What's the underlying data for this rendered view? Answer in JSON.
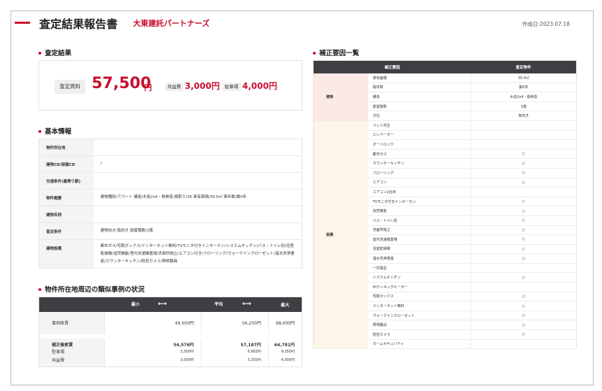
{
  "header": {
    "title": "査定結果報告書",
    "company": "大東建託パートナーズ",
    "date": "作成日:2023.07.18"
  },
  "result": {
    "heading": "査定結果",
    "rent_label": "査定賃料",
    "rent_value": "57,500",
    "rent_unit": "円",
    "common_fee_label": "共益費",
    "common_fee_value": "3,000円",
    "parking_label": "駐車場",
    "parking_value": "4,000円"
  },
  "basic": {
    "heading": "基本情報",
    "rows": [
      {
        "key": "物件所在地",
        "value": ""
      },
      {
        "key": "建物CD/部屋CD",
        "value": "/"
      },
      {
        "key": "交通条件(最寄り駅)",
        "value": ""
      },
      {
        "key": "物件概要",
        "value": "建物種別/アパート 構造/木造2x4・鉄骨造 間取り/1K 専有面積/30.0㎡ 築年数/築0年"
      },
      {
        "key": "建物名称",
        "value": ""
      },
      {
        "key": "査定条件",
        "value": "建物向き/南向き 部屋階数/1階"
      },
      {
        "key": "建物設備",
        "value": "都市ガス/宅配ボックス/インターネット無料/TVモニタ付きインターホン/システムキッチン/バス・トイレ別/浴室乾燥機/追焚機能/室内洗濯機置場/洗面所独立/エアコン付き/フローリング/ウォークインクローゼット/温水洗浄便座/カウンターキッチン/防犯カメラ/照明器具"
      }
    ]
  },
  "similar": {
    "heading": "物件所在地周辺の類似事例の状況",
    "col_min": "最小",
    "arrow": "⟷",
    "col_avg": "平均",
    "col_max": "最大",
    "rent_row": {
      "label": "事例家賃",
      "min": "49,000円",
      "avg": "56,250円",
      "max": "68,000円"
    },
    "adjusted_row": {
      "label": "補正後家賃",
      "min": "54,576円",
      "avg": "57,187円",
      "max": "64,781円"
    },
    "parking_row": {
      "label": "駐車場",
      "min": "3,300円",
      "avg": "5,683円",
      "max": "9,350円"
    },
    "common_row": {
      "label": "共益費",
      "min": "3,000円",
      "avg": "3,250円",
      "max": "4,000円"
    }
  },
  "factors": {
    "heading": "補正要因一覧",
    "col_factor": "補正要因",
    "col_property": "査定物件",
    "building_label": "建物",
    "building_items": [
      {
        "name": "専有面積",
        "value": "30.0㎡"
      },
      {
        "name": "築年数",
        "value": "築0年"
      },
      {
        "name": "構造",
        "value": "木造2x4・鉄骨造"
      },
      {
        "name": "部屋階数",
        "value": "1階"
      },
      {
        "name": "方位",
        "value": "南向き"
      }
    ],
    "equipment_label": "設備",
    "equipment_items": [
      {
        "name": "ペット共生",
        "value": ""
      },
      {
        "name": "エレベーター",
        "value": ""
      },
      {
        "name": "オートロック",
        "value": ""
      },
      {
        "name": "都市ガス",
        "value": "○"
      },
      {
        "name": "カウンターキッチン",
        "value": "○"
      },
      {
        "name": "フローリング",
        "value": "○"
      },
      {
        "name": "エアコン",
        "value": "○"
      },
      {
        "name": "エアコン2台目",
        "value": ""
      },
      {
        "name": "TVモニタ付きインターホン",
        "value": "○"
      },
      {
        "name": "追焚機能",
        "value": "○"
      },
      {
        "name": "バス・トイレ別",
        "value": "○"
      },
      {
        "name": "洗面所独立",
        "value": "○"
      },
      {
        "name": "室内洗濯機置場",
        "value": "○"
      },
      {
        "name": "浴室乾燥機",
        "value": "○"
      },
      {
        "name": "温水洗浄便座",
        "value": "○"
      },
      {
        "name": "一坪風呂",
        "value": ""
      },
      {
        "name": "システムキッチン",
        "value": "○"
      },
      {
        "name": "IHクッキングヒーター",
        "value": ""
      },
      {
        "name": "宅配ボックス",
        "value": "○"
      },
      {
        "name": "インターネット無料",
        "value": "○"
      },
      {
        "name": "ウォークインクローゼット",
        "value": "○"
      },
      {
        "name": "照明器具",
        "value": "○"
      },
      {
        "name": "防犯カメラ",
        "value": "○"
      },
      {
        "name": "ホームセキュリティ",
        "value": ""
      }
    ]
  }
}
